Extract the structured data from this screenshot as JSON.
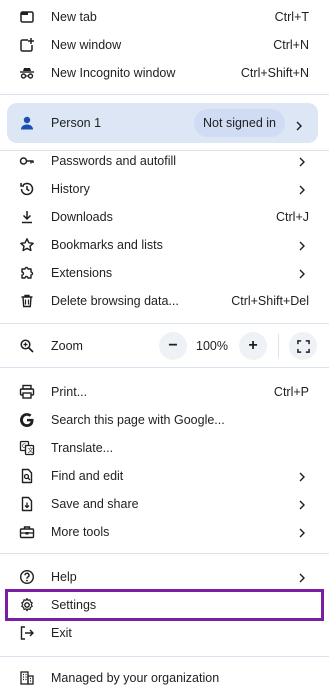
{
  "menu": {
    "new_tab": {
      "label": "New tab",
      "shortcut": "Ctrl+T"
    },
    "new_window": {
      "label": "New window",
      "shortcut": "Ctrl+N"
    },
    "new_incognito": {
      "label": "New Incognito window",
      "shortcut": "Ctrl+Shift+N"
    },
    "profile": {
      "name": "Person 1",
      "status": "Not signed in"
    },
    "passwords": {
      "label": "Passwords and autofill"
    },
    "history": {
      "label": "History"
    },
    "downloads": {
      "label": "Downloads",
      "shortcut": "Ctrl+J"
    },
    "bookmarks": {
      "label": "Bookmarks and lists"
    },
    "extensions": {
      "label": "Extensions"
    },
    "delete_data": {
      "label": "Delete browsing data...",
      "shortcut": "Ctrl+Shift+Del"
    },
    "zoom": {
      "label": "Zoom",
      "value": "100%",
      "minus": "−",
      "plus": "+"
    },
    "print": {
      "label": "Print...",
      "shortcut": "Ctrl+P"
    },
    "search_page": {
      "label": "Search this page with Google..."
    },
    "translate": {
      "label": "Translate..."
    },
    "find_edit": {
      "label": "Find and edit"
    },
    "save_share": {
      "label": "Save and share"
    },
    "more_tools": {
      "label": "More tools"
    },
    "help": {
      "label": "Help"
    },
    "settings": {
      "label": "Settings"
    },
    "exit": {
      "label": "Exit"
    },
    "managed": {
      "label": "Managed by your organization"
    }
  },
  "colors": {
    "profile_bg": "#dde6f5",
    "badge_bg": "#cfdcf3",
    "highlight": "#7b1fa2",
    "separator": "#dbe3ee"
  }
}
